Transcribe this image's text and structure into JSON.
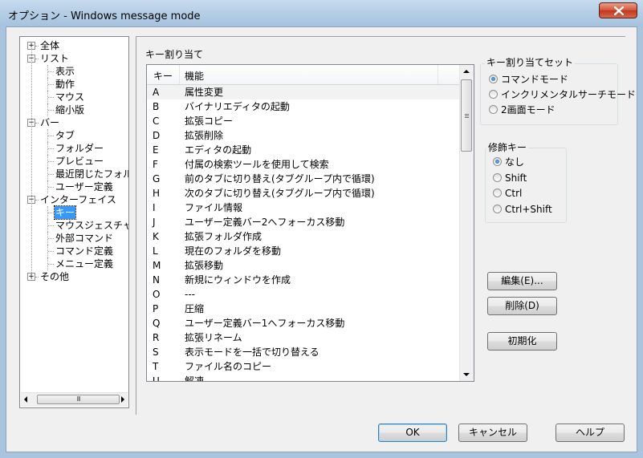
{
  "window": {
    "title": "オプション - Windows message mode"
  },
  "tree": {
    "scrollbar_grip": "III",
    "nodes": [
      {
        "label": "全体",
        "level": 0,
        "expander": "+"
      },
      {
        "label": "リスト",
        "level": 0,
        "expander": "−"
      },
      {
        "label": "表示",
        "level": 1
      },
      {
        "label": "動作",
        "level": 1
      },
      {
        "label": "マウス",
        "level": 1
      },
      {
        "label": "縮小版",
        "level": 1
      },
      {
        "label": "バー",
        "level": 0,
        "expander": "−"
      },
      {
        "label": "タブ",
        "level": 1
      },
      {
        "label": "フォルダー",
        "level": 1
      },
      {
        "label": "プレビュー",
        "level": 1
      },
      {
        "label": "最近閉じたフォルダ",
        "level": 1
      },
      {
        "label": "ユーザー定義",
        "level": 1
      },
      {
        "label": "インターフェイス",
        "level": 0,
        "expander": "−"
      },
      {
        "label": "キー",
        "level": 1,
        "selected": true
      },
      {
        "label": "マウスジェスチャ",
        "level": 1
      },
      {
        "label": "外部コマンド",
        "level": 1
      },
      {
        "label": "コマンド定義",
        "level": 1
      },
      {
        "label": "メニュー定義",
        "level": 1
      },
      {
        "label": "その他",
        "level": 0,
        "expander": "+"
      }
    ]
  },
  "key_assign": {
    "section_label": "キー割り当て",
    "columns": {
      "key": "キー",
      "function": "機能"
    },
    "rows": [
      {
        "key": "A",
        "function": "属性変更"
      },
      {
        "key": "B",
        "function": "バイナリエディタの起動"
      },
      {
        "key": "C",
        "function": "拡張コピー"
      },
      {
        "key": "D",
        "function": "拡張削除"
      },
      {
        "key": "E",
        "function": "エディタの起動"
      },
      {
        "key": "F",
        "function": "付属の検索ツールを使用して検索"
      },
      {
        "key": "G",
        "function": "前のタブに切り替え(タブグループ内で循環)"
      },
      {
        "key": "H",
        "function": "次のタブに切り替え(タブグループ内で循環)"
      },
      {
        "key": "I",
        "function": "ファイル情報"
      },
      {
        "key": "J",
        "function": "ユーザー定義バー2へフォーカス移動"
      },
      {
        "key": "K",
        "function": "拡張フォルダ作成"
      },
      {
        "key": "L",
        "function": "現在のフォルダを移動"
      },
      {
        "key": "M",
        "function": "拡張移動"
      },
      {
        "key": "N",
        "function": "新規にウィンドウを作成"
      },
      {
        "key": "O",
        "function": "---"
      },
      {
        "key": "P",
        "function": "圧縮"
      },
      {
        "key": "Q",
        "function": "ユーザー定義バー1へフォーカス移動"
      },
      {
        "key": "R",
        "function": "拡張リネーム"
      },
      {
        "key": "S",
        "function": "表示モードを一括で切り替える"
      },
      {
        "key": "T",
        "function": "ファイル名のコピー"
      },
      {
        "key": "U",
        "function": "解凍"
      }
    ]
  },
  "keyset": {
    "title": "キー割り当てセット",
    "options": [
      {
        "label": "コマンドモード",
        "checked": true
      },
      {
        "label": "インクリメンタルサーチモード",
        "checked": false
      },
      {
        "label": "2画面モード",
        "checked": false
      }
    ]
  },
  "modifier": {
    "title": "修飾キー",
    "options": [
      {
        "label": "なし",
        "checked": true
      },
      {
        "label": "Shift",
        "checked": false
      },
      {
        "label": "Ctrl",
        "checked": false
      },
      {
        "label": "Ctrl+Shift",
        "checked": false
      }
    ]
  },
  "actions": {
    "edit": "編集(E)...",
    "delete": "削除(D)",
    "reset": "初期化"
  },
  "footer": {
    "ok": "OK",
    "cancel": "キャンセル",
    "help": "ヘルプ"
  },
  "colors": {
    "selection": "#3399ff",
    "title_bar": "#b6cfe7",
    "close_button": "#c0361d"
  }
}
